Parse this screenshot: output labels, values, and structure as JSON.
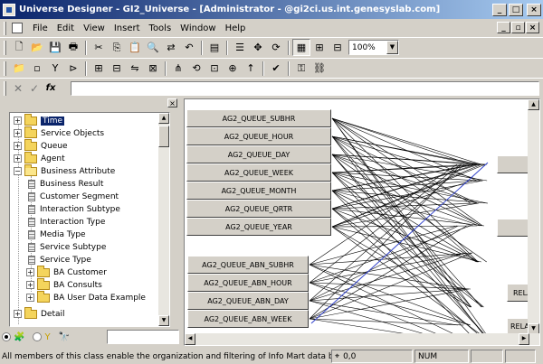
{
  "window": {
    "title": "Universe Designer - GI2_Universe - [Administrator - @gi2ci.us.int.genesyslab.com]"
  },
  "menu": [
    "File",
    "Edit",
    "View",
    "Insert",
    "Tools",
    "Window",
    "Help"
  ],
  "toolbar": {
    "zoom": "100%"
  },
  "formula": {
    "fx_label": "fx"
  },
  "tree": {
    "items": [
      {
        "label": "Time",
        "type": "folder",
        "level": 0,
        "expander": "+",
        "selected": true
      },
      {
        "label": "Service Objects",
        "type": "folder",
        "level": 0,
        "expander": "+"
      },
      {
        "label": "Queue",
        "type": "folder",
        "level": 0,
        "expander": "+"
      },
      {
        "label": "Agent",
        "type": "folder",
        "level": 0,
        "expander": "+"
      },
      {
        "label": "Business Attribute",
        "type": "folder-open",
        "level": 0,
        "expander": "-"
      },
      {
        "label": "Business Result",
        "type": "object",
        "level": 1
      },
      {
        "label": "Customer Segment",
        "type": "object",
        "level": 1
      },
      {
        "label": "Interaction Subtype",
        "type": "object",
        "level": 1
      },
      {
        "label": "Interaction Type",
        "type": "object",
        "level": 1
      },
      {
        "label": "Media Type",
        "type": "object",
        "level": 1
      },
      {
        "label": "Service Subtype",
        "type": "object",
        "level": 1
      },
      {
        "label": "Service Type",
        "type": "object",
        "level": 1
      },
      {
        "label": "BA Customer",
        "type": "folder",
        "level": 1,
        "expander": "+"
      },
      {
        "label": "BA Consults",
        "type": "folder",
        "level": 1,
        "expander": "+"
      },
      {
        "label": "BA User Data Example",
        "type": "folder",
        "level": 1,
        "expander": "+"
      },
      {
        "label": "Detail",
        "type": "folder",
        "level": 0,
        "expander": "+"
      }
    ]
  },
  "diagram": {
    "tables": [
      "AG2_QUEUE_SUBHR",
      "AG2_QUEUE_HOUR",
      "AG2_QUEUE_DAY",
      "AG2_QUEUE_WEEK",
      "AG2_QUEUE_MONTH",
      "AG2_QUEUE_QRTR",
      "AG2_QUEUE_YEAR",
      "AG2_QUEUE_ABN_SUBHR",
      "AG2_QUEUE_ABN_HOUR",
      "AG2_QUEUE_ABN_DAY",
      "AG2_QUEUE_ABN_WEEK"
    ],
    "right_tables": [
      "RELA",
      "RELA"
    ]
  },
  "status": {
    "message": "All members of this class enable the organization and filtering of Info Mart data based on",
    "coords": "0,0",
    "num": "NUM"
  }
}
